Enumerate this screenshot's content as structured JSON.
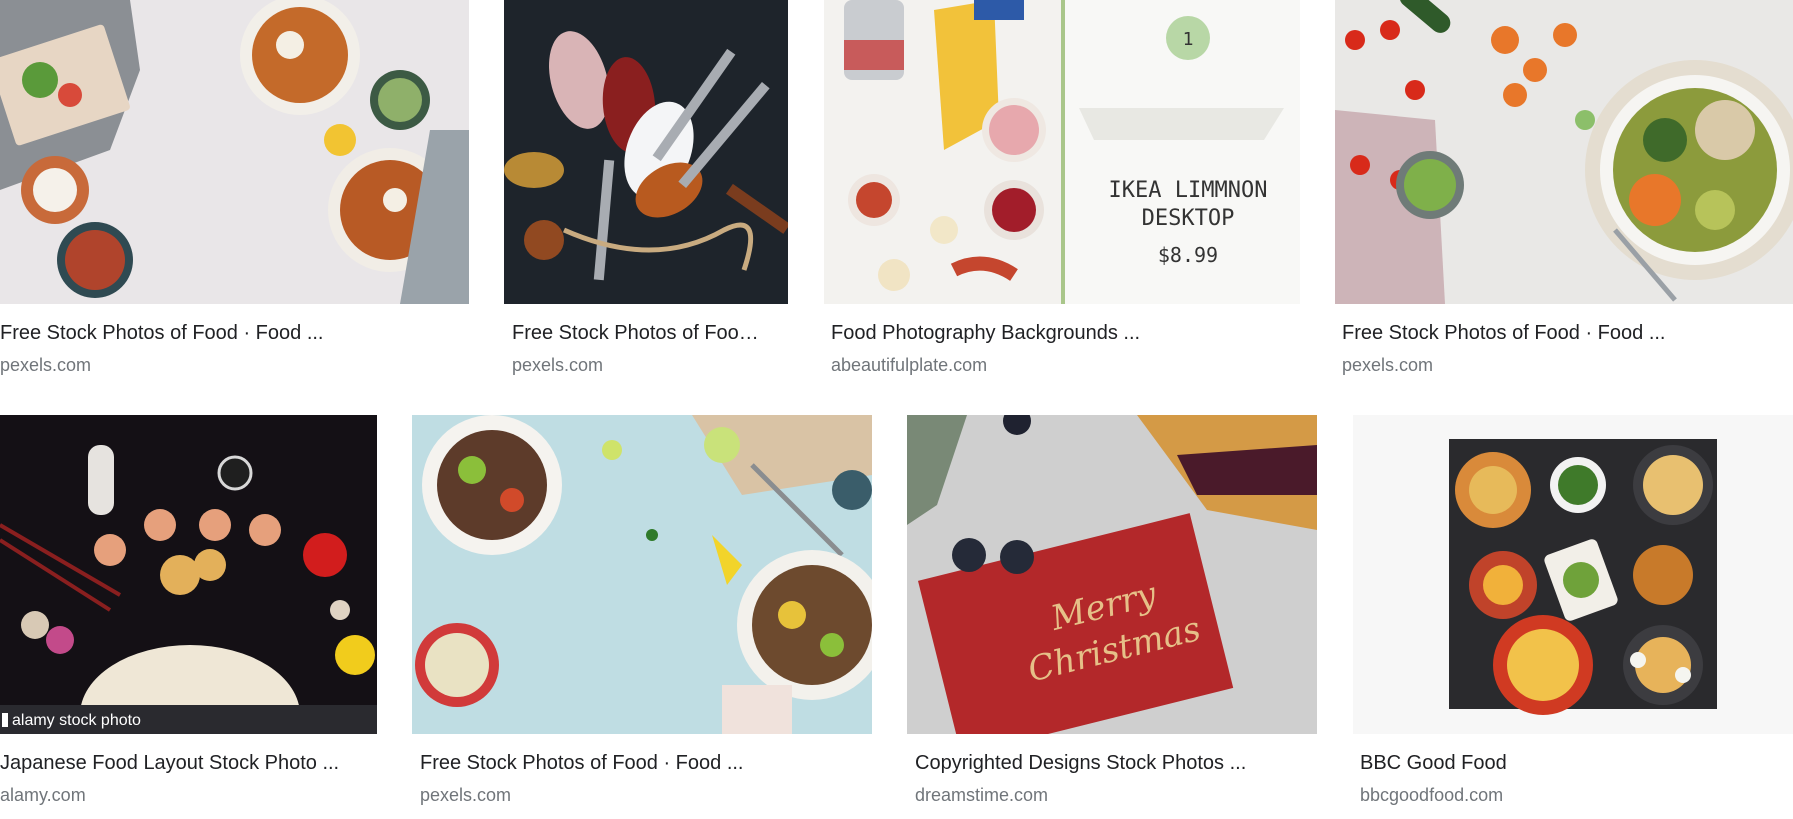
{
  "results": [
    {
      "title": "Free Stock Photos of Food · Food ...",
      "source": "pexels.com",
      "image": "flat lay of loaded fries, salad bowls and dips on a light table"
    },
    {
      "title": "Free Stock Photos of Foo…",
      "source": "pexels.com",
      "image": "spoons of salt, peppercorns and spices on a dark background"
    },
    {
      "title": "Food Photography Backgrounds ...",
      "source": "abeautifulplate.com",
      "image": "pasta and ingredients beside an Ikea Limmnon desktop price card",
      "overlay": {
        "badge": "1",
        "line1": "IKEA LIMMNON",
        "line2": "DESKTOP",
        "price": "$8.99"
      }
    },
    {
      "title": "Free Stock Photos of Food · Food ...",
      "source": "pexels.com",
      "image": "vegetable grain bowl with tomatoes, carrots and a fork"
    },
    {
      "title": "Japanese Food Layout Stock Photo ...",
      "source": "alamy.com",
      "image": "Japanese food layout with prawns, sake bottle and a paper fan",
      "overlay": {
        "watermark": "alamy stock photo"
      }
    },
    {
      "title": "Free Stock Photos of Food · Food ...",
      "source": "pexels.com",
      "image": "salad bowls and limes on a light blue surface"
    },
    {
      "title": "Copyrighted Designs Stock Photos ...",
      "source": "dreamstime.com",
      "image": "red glitter Merry Christmas card beside a berry pie",
      "overlay": {
        "card_text_1": "Merry",
        "card_text_2": "Christmas"
      }
    },
    {
      "title": "BBC Good Food",
      "source": "bbcgoodfood.com",
      "image": "overhead table of ramen bowls, edamame and side dishes"
    }
  ],
  "colors": {
    "title": "#202124",
    "source": "#70757a",
    "background": "#ffffff"
  }
}
